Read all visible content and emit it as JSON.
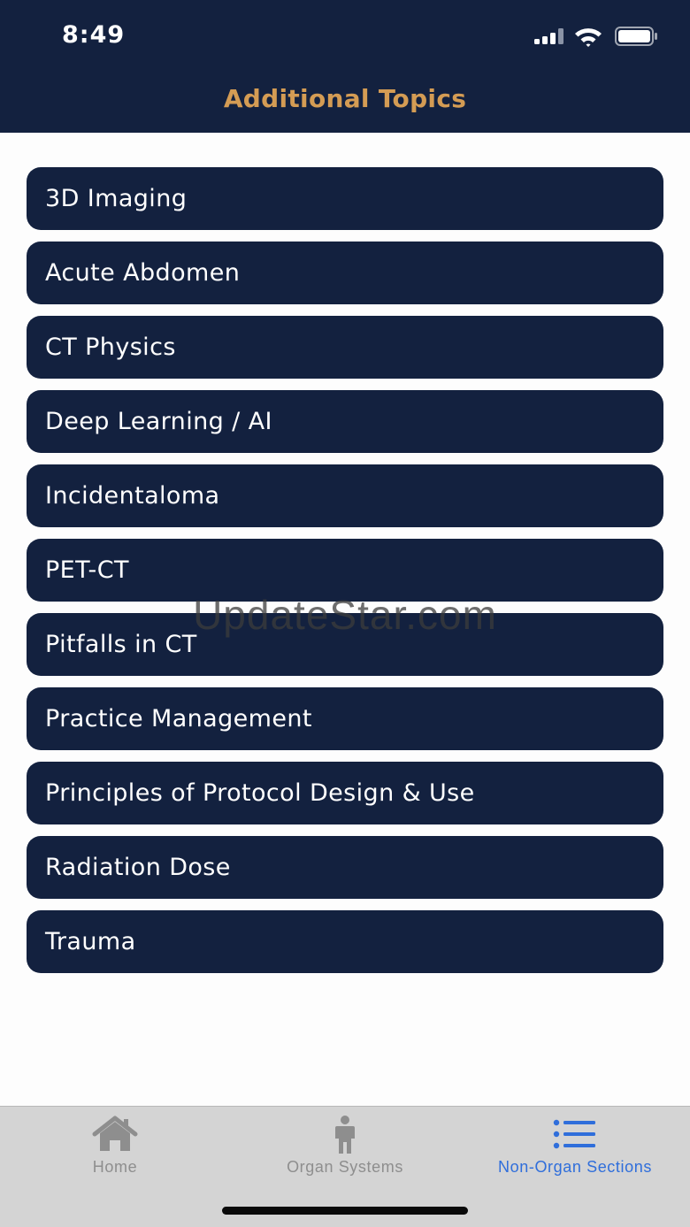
{
  "status_bar": {
    "time": "8:49"
  },
  "header": {
    "title": "Additional Topics"
  },
  "topics": [
    "3D Imaging",
    "Acute Abdomen",
    "CT Physics",
    "Deep Learning / AI",
    "Incidentaloma",
    "PET-CT",
    "Pitfalls in CT",
    "Practice Management",
    "Principles of Protocol Design & Use",
    "Radiation Dose",
    "Trauma"
  ],
  "watermark": "UpdateStar.com",
  "tab_bar": {
    "tabs": [
      {
        "label": "Home",
        "icon": "house-icon",
        "active": false
      },
      {
        "label": "Organ Systems",
        "icon": "person-icon",
        "active": false
      },
      {
        "label": "Non-Organ Sections",
        "icon": "list-icon",
        "active": true
      }
    ]
  },
  "colors": {
    "navy": "#13213f",
    "title_gold": "#d49c54",
    "active_blue": "#2f6edb",
    "tab_gray": "#8e8e8e"
  }
}
